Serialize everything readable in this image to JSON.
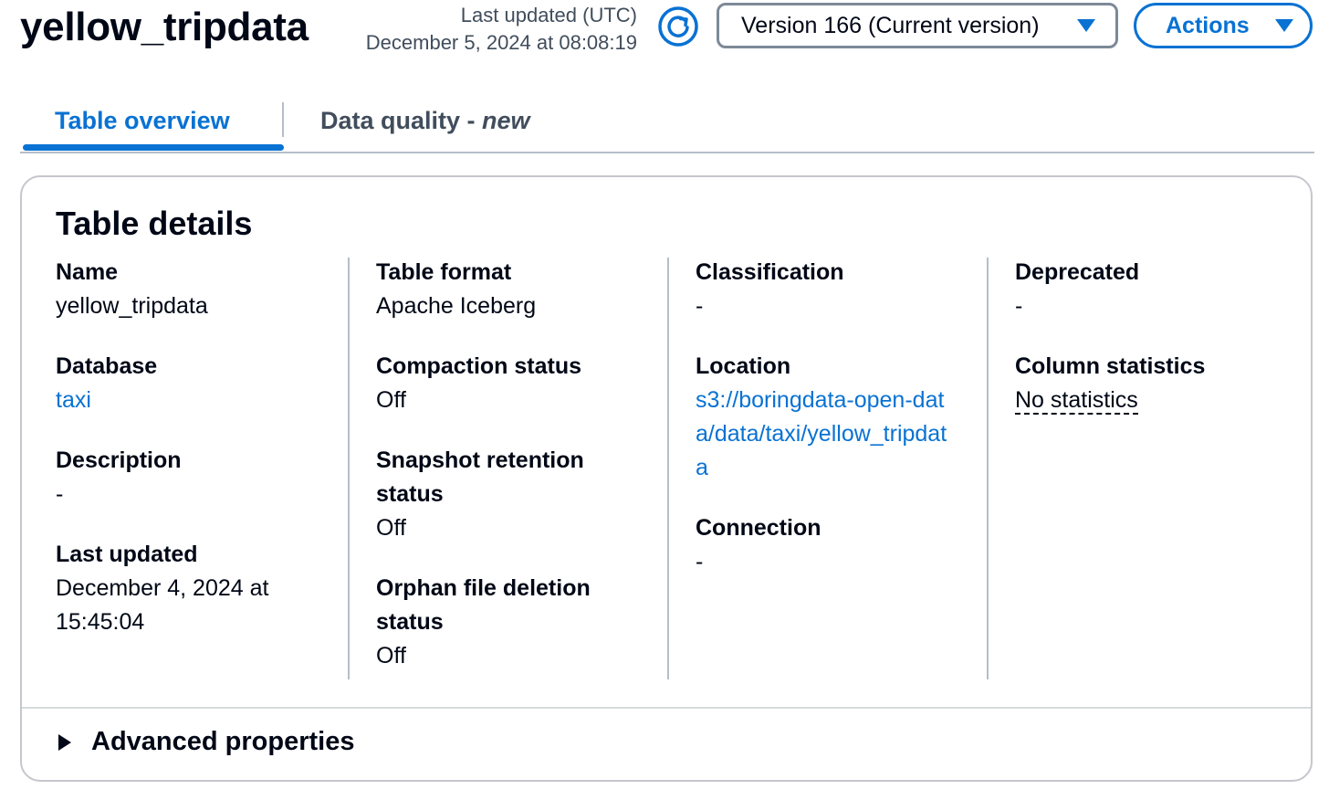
{
  "header": {
    "title": "yellow_tripdata",
    "last_updated_label": "Last updated (UTC)",
    "last_updated_value": "December 5, 2024 at 08:08:19",
    "version_select": "Version 166 (Current version)",
    "actions_label": "Actions"
  },
  "tabs": {
    "overview": "Table overview",
    "quality_main": "Data quality - ",
    "quality_new": "new"
  },
  "card": {
    "title": "Table details",
    "columns": [
      [
        {
          "label": "Name",
          "value": "yellow_tripdata"
        },
        {
          "label": "Database",
          "value": "taxi"
        },
        {
          "label": "Description",
          "value": "-"
        },
        {
          "label": "Last updated",
          "value": "December 4, 2024 at 15:45:04"
        }
      ],
      [
        {
          "label": "Table format",
          "value": "Apache Iceberg"
        },
        {
          "label": "Compaction status",
          "value": "Off"
        },
        {
          "label": "Snapshot retention status",
          "value": "Off"
        },
        {
          "label": "Orphan file deletion status",
          "value": "Off"
        }
      ],
      [
        {
          "label": "Classification",
          "value": "-"
        },
        {
          "label": "Location",
          "value": "s3://boringdata-open-data/data/taxi/yellow_tripdata"
        },
        {
          "label": "Connection",
          "value": "-"
        }
      ],
      [
        {
          "label": "Deprecated",
          "value": "-"
        },
        {
          "label": "Column statistics",
          "value": "No statistics"
        }
      ]
    ],
    "advanced_label": "Advanced properties"
  },
  "colors": {
    "accent": "#0972d3",
    "text": "#000716",
    "muted": "#414d5c",
    "border": "#b6bec9"
  },
  "icons": {
    "refresh": "refresh-icon",
    "dropdown": "caret-down-icon",
    "expand": "caret-right-icon"
  }
}
